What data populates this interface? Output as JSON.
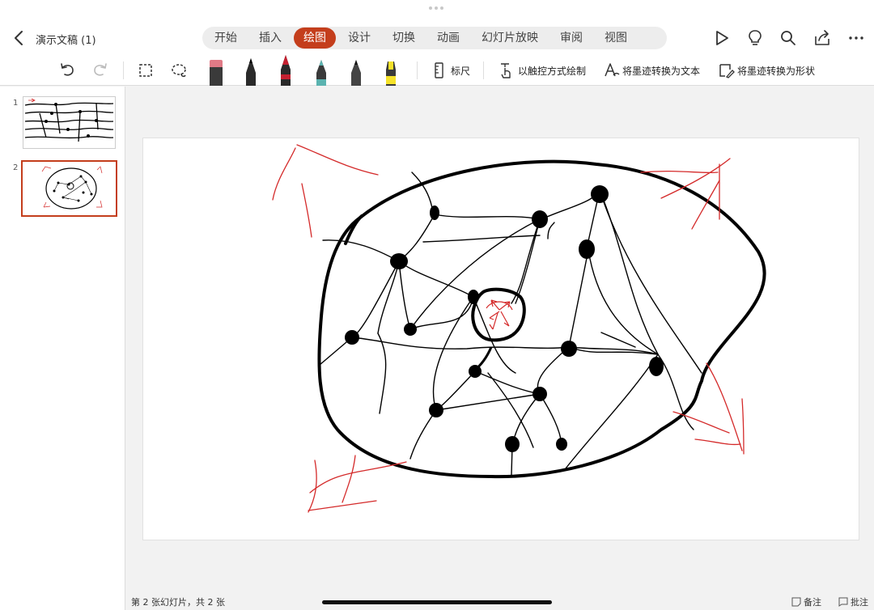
{
  "doc": {
    "title": "演示文稿 (1)"
  },
  "tabs": [
    {
      "label": "开始"
    },
    {
      "label": "插入"
    },
    {
      "label": "绘图",
      "active": true
    },
    {
      "label": "设计"
    },
    {
      "label": "切换"
    },
    {
      "label": "动画"
    },
    {
      "label": "幻灯片放映"
    },
    {
      "label": "审阅"
    },
    {
      "label": "视图"
    }
  ],
  "toolbar": {
    "ruler": "标尺",
    "touch_draw": "以触控方式绘制",
    "ink_to_text": "将墨迹转换为文本",
    "ink_to_shape": "将墨迹转换为形状"
  },
  "pens": [
    {
      "name": "eraser",
      "color": "#e07a86"
    },
    {
      "name": "pen-black",
      "color": "#1a1a1a"
    },
    {
      "name": "pen-red",
      "color": "#c42030"
    },
    {
      "name": "pencil-teal",
      "color": "#5bb3b0"
    },
    {
      "name": "pen-gray",
      "color": "#333333"
    },
    {
      "name": "highlighter-yellow",
      "color": "#f5e22a"
    }
  ],
  "slides": [
    {
      "number": "1"
    },
    {
      "number": "2",
      "selected": true
    }
  ],
  "status": {
    "text": "第 2 张幻灯片，共 2 张",
    "notes": "备注",
    "comments": "批注"
  },
  "colors": {
    "accent": "#c43e1c",
    "ink_black": "#000000",
    "ink_red": "#d42a2a"
  }
}
